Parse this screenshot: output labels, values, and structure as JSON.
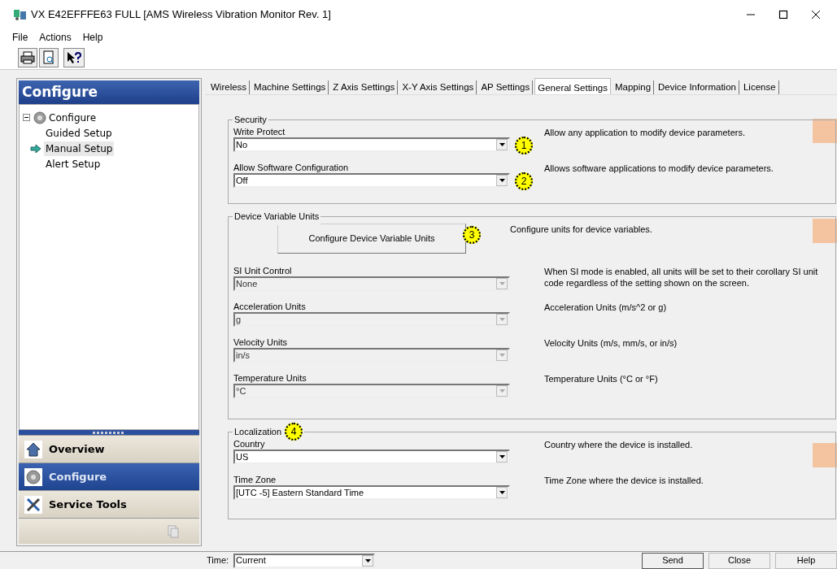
{
  "window": {
    "title": "VX E42EFFFE63 FULL [AMS Wireless Vibration Monitor Rev. 1]"
  },
  "menu": [
    "File",
    "Actions",
    "Help"
  ],
  "sidebar": {
    "header": "Configure",
    "tree": [
      {
        "label": "Configure",
        "expanded": true,
        "children": [
          {
            "label": "Guided Setup",
            "selected": false
          },
          {
            "label": "Manual Setup",
            "selected": true
          },
          {
            "label": "Alert Setup",
            "selected": false
          }
        ]
      }
    ],
    "nav": [
      {
        "label": "Overview",
        "selected": false
      },
      {
        "label": "Configure",
        "selected": true
      },
      {
        "label": "Service Tools",
        "selected": false
      }
    ]
  },
  "tabs": [
    {
      "label": "Wireless",
      "selected": false
    },
    {
      "label": "Machine Settings",
      "selected": false
    },
    {
      "label": "Z Axis Settings",
      "selected": false
    },
    {
      "label": "X-Y Axis Settings",
      "selected": false
    },
    {
      "label": "AP Settings",
      "selected": false
    },
    {
      "label": "General Settings",
      "selected": true
    },
    {
      "label": "Mapping",
      "selected": false
    },
    {
      "label": "Device Information",
      "selected": false
    },
    {
      "label": "License",
      "selected": false
    }
  ],
  "groups": [
    {
      "title": "Security",
      "rows": [
        {
          "kind": "dropdown",
          "label": "Write Protect",
          "value": "No",
          "disabled": false,
          "callout": "1",
          "description": "Allow any application to modify device parameters."
        },
        {
          "kind": "dropdown",
          "label": "Allow Software Configuration",
          "value": "Off",
          "disabled": false,
          "callout": "2",
          "description": "Allows software applications to modify device parameters."
        }
      ]
    },
    {
      "title": "Device Variable Units",
      "rows": [
        {
          "kind": "button",
          "label": "Configure Device Variable Units",
          "callout": "3",
          "description": "Configure units for device variables."
        },
        {
          "kind": "dropdown",
          "label": "SI Unit Control",
          "value": "None",
          "disabled": true,
          "description": "When SI mode is enabled, all units will be set to their corollary SI unit code regardless of the setting shown on the screen."
        },
        {
          "kind": "dropdown",
          "label": "Acceleration Units",
          "value": "g",
          "disabled": true,
          "description": "Acceleration Units (m/s^2 or g)"
        },
        {
          "kind": "dropdown",
          "label": "Velocity Units",
          "value": "in/s",
          "disabled": true,
          "description": "Velocity Units (m/s, mm/s, or in/s)"
        },
        {
          "kind": "dropdown",
          "label": "Temperature Units",
          "value": "°C",
          "disabled": true,
          "description": "Temperature Units (°C or °F)"
        }
      ]
    },
    {
      "title": "Localization",
      "callout": "4",
      "rows": [
        {
          "kind": "dropdown",
          "label": "Country",
          "value": "US",
          "disabled": false,
          "description": "Country where the device is installed."
        },
        {
          "kind": "dropdown",
          "label": "Time Zone",
          "value": "[UTC -5] Eastern Standard Time",
          "disabled": false,
          "description": "Time Zone where the device is installed."
        }
      ]
    }
  ],
  "footer": {
    "time_label": "Time:",
    "time_value": "Current",
    "buttons": [
      "Send",
      "Close",
      "Help"
    ]
  }
}
